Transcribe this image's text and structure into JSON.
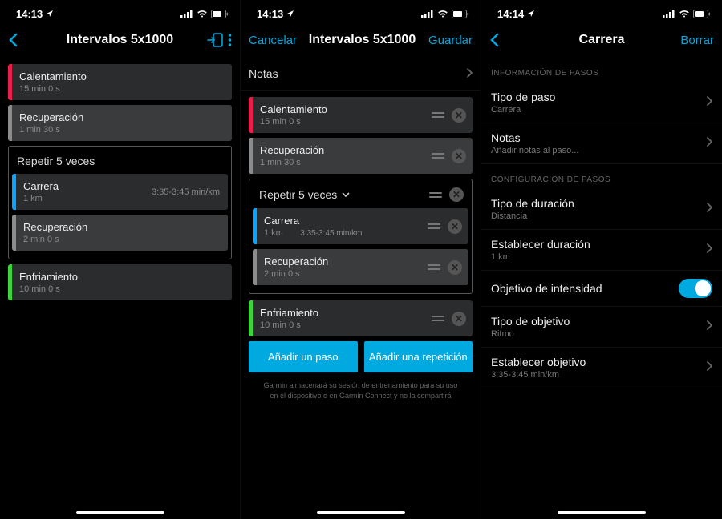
{
  "colors": {
    "accent": "#00a9e0",
    "stripe_warmup": "#e91e4b",
    "stripe_recovery": "#8a8c8e",
    "stripe_run": "#0aa3ff",
    "stripe_cooldown": "#3bd43b"
  },
  "screen1": {
    "time": "14:13",
    "title": "Intervalos 5x1000",
    "steps": {
      "warmup": {
        "label": "Calentamiento",
        "sub": "15 min 0 s"
      },
      "recovery1": {
        "label": "Recuperación",
        "sub": "1 min 30 s"
      },
      "repeat_label": "Repetir 5 veces",
      "run": {
        "label": "Carrera",
        "sub": "1 km",
        "pace": "3:35-3:45 min/km"
      },
      "recovery2": {
        "label": "Recuperación",
        "sub": "2 min 0 s"
      },
      "cooldown": {
        "label": "Enfriamiento",
        "sub": "10 min 0 s"
      }
    }
  },
  "screen2": {
    "time": "14:13",
    "cancel": "Cancelar",
    "title": "Intervalos 5x1000",
    "save": "Guardar",
    "notes_label": "Notas",
    "steps": {
      "warmup": {
        "label": "Calentamiento",
        "sub": "15 min 0 s"
      },
      "recovery1": {
        "label": "Recuperación",
        "sub": "1 min 30 s"
      },
      "repeat_label": "Repetir 5 veces",
      "run": {
        "label": "Carrera",
        "sub": "1 km",
        "pace": "3:35-3:45 min/km"
      },
      "recovery2": {
        "label": "Recuperación",
        "sub": "2 min 0 s"
      },
      "cooldown": {
        "label": "Enfriamiento",
        "sub": "10 min 0 s"
      }
    },
    "add_step": "Añadir un paso",
    "add_repeat": "Añadir una repetición",
    "disclaimer": "Garmin almacenará su sesión de entrenamiento para su uso en el dispositivo o en Garmin Connect y no la compartirá"
  },
  "screen3": {
    "time": "14:14",
    "title": "Carrera",
    "delete": "Borrar",
    "section_info": "INFORMACIÓN DE PASOS",
    "rows": {
      "step_type": {
        "title": "Tipo de paso",
        "sub": "Carrera"
      },
      "notes": {
        "title": "Notas",
        "sub": "Añadir notas al paso..."
      }
    },
    "section_config": "CONFIGURACIÓN DE PASOS",
    "rows2": {
      "duration_type": {
        "title": "Tipo de duración",
        "sub": "Distancia"
      },
      "set_duration": {
        "title": "Establecer duración",
        "sub": "1 km"
      },
      "intensity_target": {
        "title": "Objetivo de intensidad"
      },
      "target_type": {
        "title": "Tipo de objetivo",
        "sub": "Ritmo"
      },
      "set_target": {
        "title": "Establecer objetivo",
        "sub": "3:35-3:45 min/km"
      }
    }
  }
}
